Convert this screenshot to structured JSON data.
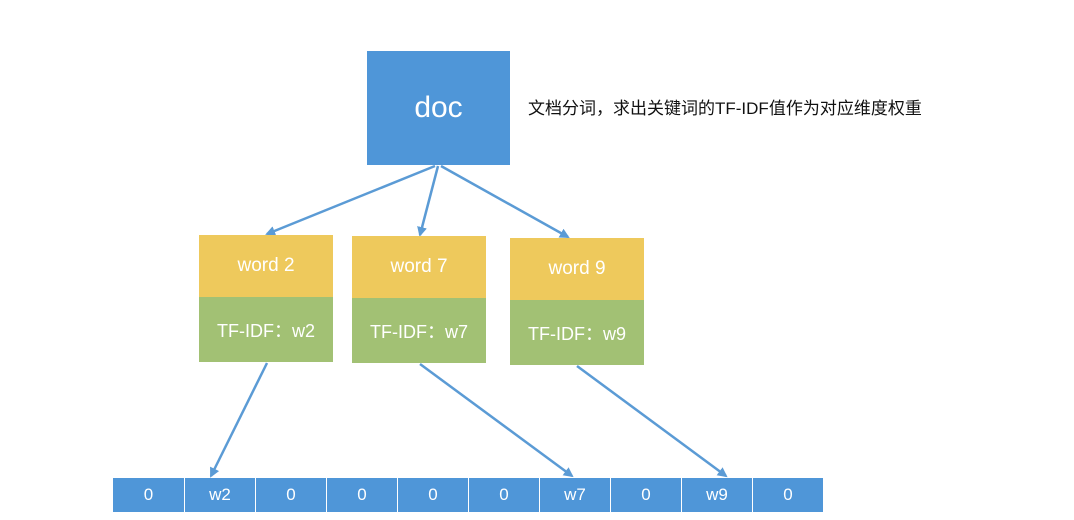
{
  "doc_label": "doc",
  "caption": "文档分词，求出关键词的TF-IDF值作为对应维度权重",
  "words": [
    {
      "word": "word 2",
      "tfidf": "TF-IDF：w2"
    },
    {
      "word": "word 7",
      "tfidf": "TF-IDF：w7"
    },
    {
      "word": "word 9",
      "tfidf": "TF-IDF：w9"
    }
  ],
  "vector": [
    "0",
    "w2",
    "0",
    "0",
    "0",
    "0",
    "w7",
    "0",
    "w9",
    "0"
  ],
  "colors": {
    "blue": "#4f96d8",
    "yellow": "#eec95c",
    "green": "#a2c174",
    "arrow": "#5b9bd5"
  }
}
